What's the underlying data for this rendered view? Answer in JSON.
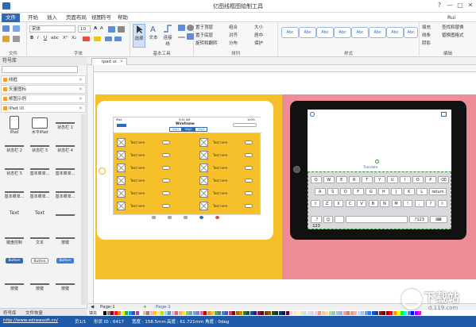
{
  "window": {
    "title": "亿图线框图绘制工具",
    "controls": [
      "?",
      "—",
      "□",
      "✕"
    ]
  },
  "menu": {
    "tabs": [
      "文件",
      "开始",
      "插入",
      "页面布局",
      "视图",
      "符号",
      "帮助"
    ],
    "active": 1,
    "user": "Rui"
  },
  "ribbon": {
    "font_name": "宋体",
    "font_size": "10",
    "groups": [
      "文件",
      "字体",
      "基本工具",
      "排列",
      "样式",
      "编辑"
    ],
    "tools": {
      "select": "选择",
      "text": "文本",
      "connector": "连接线"
    },
    "arrange": {
      "top": "置于顶层",
      "bottom": "置于底层",
      "rotate": "旋转和翻转",
      "group": "组合",
      "align": "对齐",
      "distribute": "分布",
      "size": "大小",
      "center": "居中",
      "protect": "保护"
    },
    "style_boxes": [
      "Abc",
      "Abc",
      "Abc",
      "Abc",
      "Abc",
      "Abc",
      "Abc",
      "Abc"
    ],
    "edit": {
      "fill": "填充",
      "line": "线条",
      "shadow": "阴影",
      "find": "查找和替换",
      "format_painter": "替换图格式"
    }
  },
  "left_panel": {
    "title": "符号库",
    "categories": [
      "线框",
      "矢量图标",
      "帧图示例",
      "iPad UI"
    ],
    "shapes": [
      [
        "iPad",
        "水平iPad",
        "状态栏 1"
      ],
      [
        "状态栏 2",
        "状态栏 3",
        "状态栏 4"
      ],
      [
        "状态栏 5",
        "基本菜单...",
        "基本菜单..."
      ],
      [
        "基本菜单...",
        "基本菜单...",
        "基本菜单..."
      ],
      [
        "Text",
        "Text",
        ""
      ],
      [
        "键盘控制",
        "文本",
        "按键"
      ],
      [
        "Button",
        "Button",
        "Button"
      ],
      [
        "按键",
        "按键",
        "按键"
      ]
    ],
    "bottom_tabs": [
      "符号库",
      "文件恢复"
    ]
  },
  "doc_tab": {
    "label": "ipad ui",
    "close": "✕"
  },
  "canvas": {
    "ipad1": {
      "status_left": "iPad",
      "status_time": "9:41 AM",
      "status_right": "100%",
      "header_title": "Wireframe",
      "segments": [
        "Seg1",
        "Seg2",
        "Seg3"
      ],
      "row_text": "Text here",
      "rows": 6
    },
    "ipad2": {
      "translate": "Translate",
      "keyboard_rows": [
        [
          "Q",
          "W",
          "E",
          "R",
          "T",
          "Y",
          "U",
          "I",
          "O",
          "P",
          "⌫"
        ],
        [
          "A",
          "S",
          "D",
          "F",
          "G",
          "H",
          "J",
          "K",
          "L",
          "return"
        ],
        [
          "⇧",
          "Z",
          "X",
          "C",
          "V",
          "B",
          "N",
          "M",
          "!",
          ",",
          "?",
          "⇧"
        ],
        [
          ".?123",
          "☺",
          "",
          "",
          ".?123",
          "⌨"
        ]
      ]
    }
  },
  "page_bar": {
    "page_name": "Page-1",
    "add": "+",
    "active_page": "Page-1"
  },
  "palette": {
    "label": "填充",
    "colors": [
      "#000000",
      "#7f7f7f",
      "#880015",
      "#ed1c24",
      "#ff7f27",
      "#fff200",
      "#22b14c",
      "#00a2e8",
      "#3f48cc",
      "#a349a4",
      "#ffffff",
      "#c3c3c3",
      "#b97a57",
      "#ffaec9",
      "#ffc90e",
      "#efe4b0",
      "#b5e61d",
      "#99d9ea",
      "#7092be",
      "#c8bfe7",
      "#e06666",
      "#f6b26b",
      "#ffd966",
      "#93c47d",
      "#76a5af",
      "#6fa8dc",
      "#8e7cc3",
      "#c27ba0",
      "#cc0000",
      "#e69138",
      "#f1c232",
      "#6aa84f",
      "#45818e",
      "#3d85c6",
      "#674ea7",
      "#a64d79",
      "#990000",
      "#b45f06",
      "#bf9000",
      "#38761d",
      "#134f5c",
      "#0b5394",
      "#351c75",
      "#741b47",
      "#660000",
      "#783f04",
      "#7f6000",
      "#274e13",
      "#0c343d",
      "#073763",
      "#20124d",
      "#4c1130",
      "#f4cccc",
      "#fce5cd",
      "#fff2cc",
      "#d9ead3",
      "#d0e0e3",
      "#cfe2f3",
      "#d9d2e9",
      "#ead1dc",
      "#ea9999",
      "#f9cb9c",
      "#ffe599",
      "#b6d7a8",
      "#a2c4c9",
      "#9fc5e8",
      "#b4a7d6",
      "#d5a6bd",
      "#dd7e6b",
      "#ea9999",
      "#e6b8af",
      "#c9daf8",
      "#a4c2f4",
      "#6d9eeb",
      "#3c78d8",
      "#1155cc",
      "#1c4587",
      "#85200c",
      "#5b0f00",
      "#980000",
      "#ff0000",
      "#ff9900",
      "#ffff00",
      "#00ff00",
      "#00ffff",
      "#4a86e8",
      "#0000ff",
      "#9900ff",
      "#ff00ff"
    ]
  },
  "status": {
    "url": "http://www.edrawsoft.cn/",
    "page": "页1/1",
    "shape_id": "形状 ID : 6417",
    "width": "宽度 : 158.5mm",
    "height": "高度 : 61.721mm",
    "angle": "角度 : 0deg"
  },
  "watermark": {
    "big": "下载站",
    "small": "d.119.com"
  },
  "colors": {
    "accent": "#2d6cb5",
    "yellow_page": "#f6c02b",
    "pink_page": "#ee8d98",
    "status": "#1e5aa8"
  }
}
